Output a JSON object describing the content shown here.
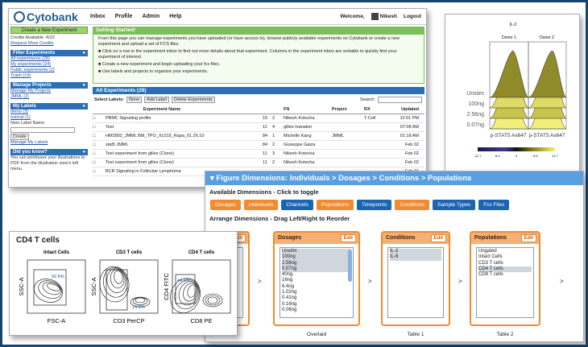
{
  "cytobank": {
    "logo": "Cytobank",
    "nav": [
      "Inbox",
      "Profile",
      "Admin",
      "Help"
    ],
    "welcome": "Welcome,",
    "user": "Nikesh",
    "logout": "Logout",
    "create_btn": "Create a New Experiment",
    "credits": "Credits Available: 4/10",
    "request_credits": "Request More Credits",
    "filter_head": "Filter Experiments",
    "filters": [
      "All experiments (28)",
      "My experiments (24)",
      "Public experiments (2)",
      "Trash (14)"
    ],
    "projects_head": "Manage Projects",
    "projects": [
      "Manage My Projects",
      "JMML (2)"
    ],
    "labels_head": "My Labels",
    "labels": [
      "demo (3)",
      "tutorial (1)"
    ],
    "new_label": "New Label Name",
    "create_label": "Create",
    "manage_labels": "Manage My Labels",
    "know_head": "Did you know?",
    "know_text": "You can print/save your illustrations to PDF from the illustration view's left menu.",
    "gs_head": "Getting Started!",
    "gs_intro": "From this page you can manage experiments you have uploaded (or have access to), browse publicly available experiments on Cytobank or create a new experiment and upload a set of FCS files.",
    "gs_items": [
      "Click on a row in the experiment inbox to find out more details about that experiment. Columns in the experiment inbox are sortable to quickly find your experiment of interest.",
      "Create a new experiment and begin uploading your fcs files.",
      "Use labels and projects to organize your experiments."
    ],
    "exp_head": "All Experiments (28)",
    "select_label": "Select Labels:",
    "tool_btns": [
      "None",
      "Add Label",
      "Delete Experiments"
    ],
    "search": "Search:",
    "cols": [
      "Experiment Name",
      "",
      "",
      "FN",
      "Project",
      "RX",
      "Updated"
    ],
    "rows": [
      [
        "PBMC Signaling profile",
        "15",
        "2",
        "Nikesh Kotecha",
        "",
        "T-Cell",
        "12:01 PM"
      ],
      [
        "Test",
        "11",
        "4",
        "gilles manalon",
        "",
        "",
        "07:08 AM"
      ],
      [
        "HM2892_JMML BM_TPO_XL019_Rapa_01.26.10",
        "84",
        "1",
        "Michelle Kang",
        "JMML",
        "",
        "01:18 AM"
      ],
      [
        "stat5 JMML",
        "84",
        "2",
        "Giuseppe Gaiza",
        "",
        "",
        "Feb 02"
      ],
      [
        "Test experiment from gilles (Clone)",
        "11",
        "3",
        "Nikesh Kotecha",
        "",
        "",
        "Feb 02"
      ],
      [
        "Test experiment from gilles (Clone)",
        "11",
        "2",
        "Nikesh Kotecha",
        "",
        "",
        "Feb 02"
      ],
      [
        "BCR Signaling in Follicular Lymphoma",
        "",
        "",
        "",
        "",
        "",
        "Feb 01"
      ]
    ]
  },
  "il": {
    "title": "IL-2",
    "donors": [
      "Donor 1",
      "Donor 2"
    ],
    "rows": [
      "Unstim",
      "100ng",
      "2.56ng",
      "0.07ng"
    ],
    "xlabel": "p-STAT5 Ax647",
    "scale": [
      "-12.7",
      "-8.4",
      "0",
      "8.4",
      "12.7"
    ]
  },
  "dims": {
    "title": "Figure Dimensions: Individuals > Dosages > Conditions > Populations",
    "available": "Available Dimensions - Click to toggle",
    "buttons": [
      {
        "label": "Dosages",
        "on": true
      },
      {
        "label": "Individuals",
        "on": true
      },
      {
        "label": "Channels",
        "on": false
      },
      {
        "label": "Populations",
        "on": true
      },
      {
        "label": "Timepoints",
        "on": false
      },
      {
        "label": "Conditions",
        "on": true
      },
      {
        "label": "Sample Types",
        "on": false
      },
      {
        "label": "Fcs Files",
        "on": false
      }
    ],
    "arrange": "Arrange Dimensions - Drag Left/Right to Reorder",
    "edit": "Edit",
    "boxes": [
      {
        "title": "",
        "items": [
          "",
          ""
        ],
        "foot": "ns"
      },
      {
        "title": "Dosages",
        "items": [
          "Unstim",
          "100ng",
          "2.56ng",
          "0.07ng",
          "40ng",
          "16ng",
          "6.4ng",
          "1.02ng",
          "0.41ng",
          "0.16ng",
          "0.06ng"
        ],
        "foot": "Overlaid"
      },
      {
        "title": "Conditions",
        "items": [
          "IL-2",
          "IL-6"
        ],
        "foot": "Table 1"
      },
      {
        "title": "Populations",
        "items": [
          "Ungated",
          "Intact Cells",
          "CD3 T cells",
          "CD4 T cells",
          "CD8 T cells"
        ],
        "foot": "Table 2"
      }
    ]
  },
  "cd4": {
    "title": "CD4 T cells",
    "plots": [
      {
        "head": "Intact Cells",
        "x": "FSC-A",
        "y": "SSC-A",
        "gate": "92.6%"
      },
      {
        "head": "CD3 T cells",
        "x": "CD3 PerCP",
        "y": "SSC-A",
        "gate": "14.8%"
      },
      {
        "head": "CD4 T cells",
        "x": "CD8 PE",
        "y": "CD4 FITC",
        "gate": "44.6%"
      }
    ]
  }
}
